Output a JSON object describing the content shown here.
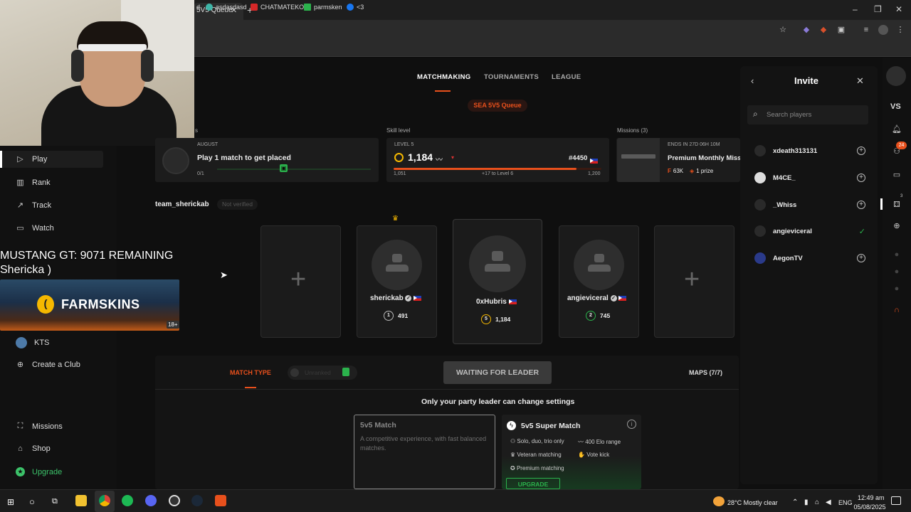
{
  "browser": {
    "tab_title": "5V5 Queue",
    "window_controls": [
      "–",
      "❐",
      "✕"
    ],
    "bookmarks": [
      {
        "label": "d",
        "color": "#888888"
      },
      {
        "label": "asdasdasd",
        "color": "#3fb6a8"
      },
      {
        "label": "CHATMATEKO",
        "color": "#d62828"
      },
      {
        "label": "parmsken",
        "color": "#2bb24c"
      },
      {
        "label": "<3",
        "color": "#1877f2"
      }
    ]
  },
  "overlay": {
    "mustang_line1": "MUSTANG GT: 9071 REMAINING",
    "mustang_line2": "Shericka  )",
    "farm_brand": "FARMSKINS",
    "farm_age": "18+"
  },
  "nav": {
    "items": [
      {
        "label": "Play",
        "icon": "play-icon"
      },
      {
        "label": "Rank",
        "icon": "rank-icon"
      },
      {
        "label": "Track",
        "icon": "track-icon"
      },
      {
        "label": "Watch",
        "icon": "watch-icon"
      },
      {
        "label": "KTS",
        "icon": "club-icon"
      },
      {
        "label": "Create a Club",
        "icon": "plus-circle-icon"
      },
      {
        "label": "Missions",
        "icon": "missions-icon"
      },
      {
        "label": "Shop",
        "icon": "shop-icon"
      },
      {
        "label": "Upgrade",
        "icon": "upgrade-star-icon"
      }
    ]
  },
  "top_tabs": {
    "matchmaking": "MATCHMAKING",
    "tournaments": "TOURNAMENTS",
    "league": "LEAGUE",
    "queue": "SEA 5V5 Queue"
  },
  "cards": {
    "placement": {
      "header": "s",
      "month": "AUGUST",
      "title": "Play 1 match to get placed",
      "progress_text": "0/1",
      "progress": 0.0
    },
    "skill": {
      "header": "Skill level",
      "level_label": "LEVEL 5",
      "elo": "1,184",
      "rank": "#4450",
      "min": "1,051",
      "to_next": "+17 to Level 6",
      "max": "1,200",
      "progress": 0.88
    },
    "missions": {
      "header": "Missions (3)",
      "ends": "ENDS IN 27D 06H 10M",
      "title": "Premium Monthly Miss",
      "reward1": "63K",
      "reward2": "1 prize"
    }
  },
  "team": {
    "name": "team_sherickab",
    "status": "Not verified"
  },
  "party": [
    {
      "type": "empty"
    },
    {
      "type": "player",
      "name": "sherickab",
      "level": "1",
      "elo": "491",
      "leader": true
    },
    {
      "type": "player",
      "name": "0xHubris",
      "level": "5",
      "elo": "1,184",
      "leader": false
    },
    {
      "type": "player",
      "name": "angieviceral",
      "level": "2",
      "elo": "745",
      "leader": false
    },
    {
      "type": "empty"
    }
  ],
  "settings": {
    "match_type_label": "MATCH TYPE",
    "locked_label": "Unranked",
    "waiting": "WAITING FOR LEADER",
    "maps": "MAPS (7/7)",
    "notice": "Only your party leader can change settings",
    "mode1_title": "5v5 Match",
    "mode1_desc": "A competitive experience, with fast balanced matches.",
    "mode2_title": "5v5 Super Match",
    "mode2_features": [
      "Solo, duo, trio only",
      "400 Elo range",
      "Veteran matching",
      "Vote kick",
      "Premium matching"
    ],
    "upgrade": "UPGRADE"
  },
  "invite": {
    "title": "Invite",
    "search_placeholder": "Search players",
    "players": [
      {
        "name": "xdeath313131",
        "status": "add"
      },
      {
        "name": "M4CE_",
        "status": "add"
      },
      {
        "name": "_Whiss",
        "status": "add"
      },
      {
        "name": "angieviceral",
        "status": "invited"
      },
      {
        "name": "AegonTV",
        "status": "add"
      }
    ]
  },
  "rail": {
    "vs": "VS",
    "friends_badge": "24",
    "party_badge": "3"
  },
  "taskbar": {
    "weather": "28°C  Mostly clear",
    "lang": "ENG",
    "time": "12:49 am",
    "date": "05/08/2025"
  },
  "colors": {
    "accent": "#e8501c",
    "green": "#2bb24c",
    "bg": "#0f0f0f",
    "card": "#1c1c1c"
  }
}
